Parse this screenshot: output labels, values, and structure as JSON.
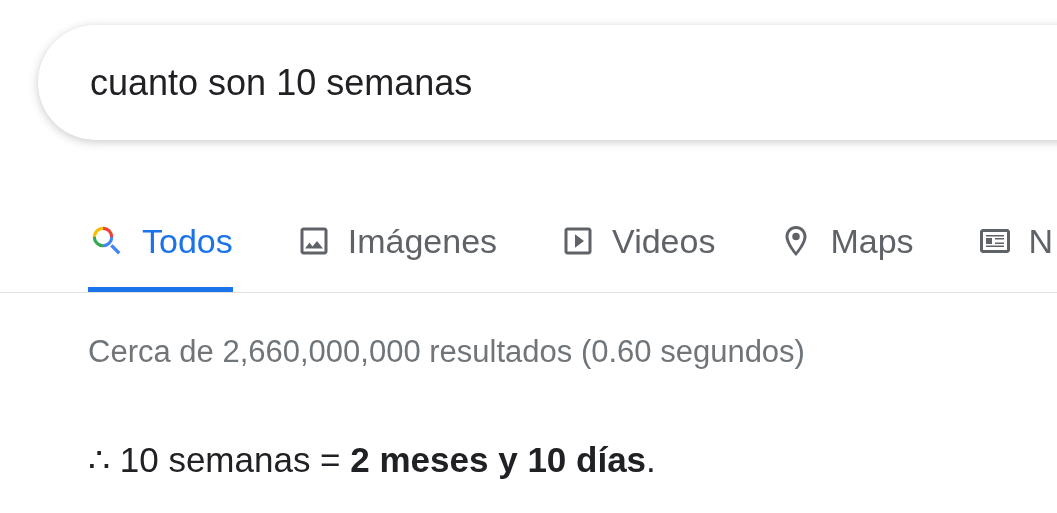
{
  "search": {
    "value": "cuanto son 10 semanas"
  },
  "tabs": [
    {
      "label": "Todos",
      "kind": "all",
      "selected": true
    },
    {
      "label": "Imágenes",
      "kind": "images",
      "selected": false
    },
    {
      "label": "Videos",
      "kind": "videos",
      "selected": false
    },
    {
      "label": "Maps",
      "kind": "maps",
      "selected": false
    },
    {
      "label": "N",
      "kind": "news",
      "selected": false
    }
  ],
  "result_stats": "Cerca de 2,660,000,000 resultados (0.60 segundos)",
  "answer": "∴ 10 semanas = **2 meses y 10 días**."
}
